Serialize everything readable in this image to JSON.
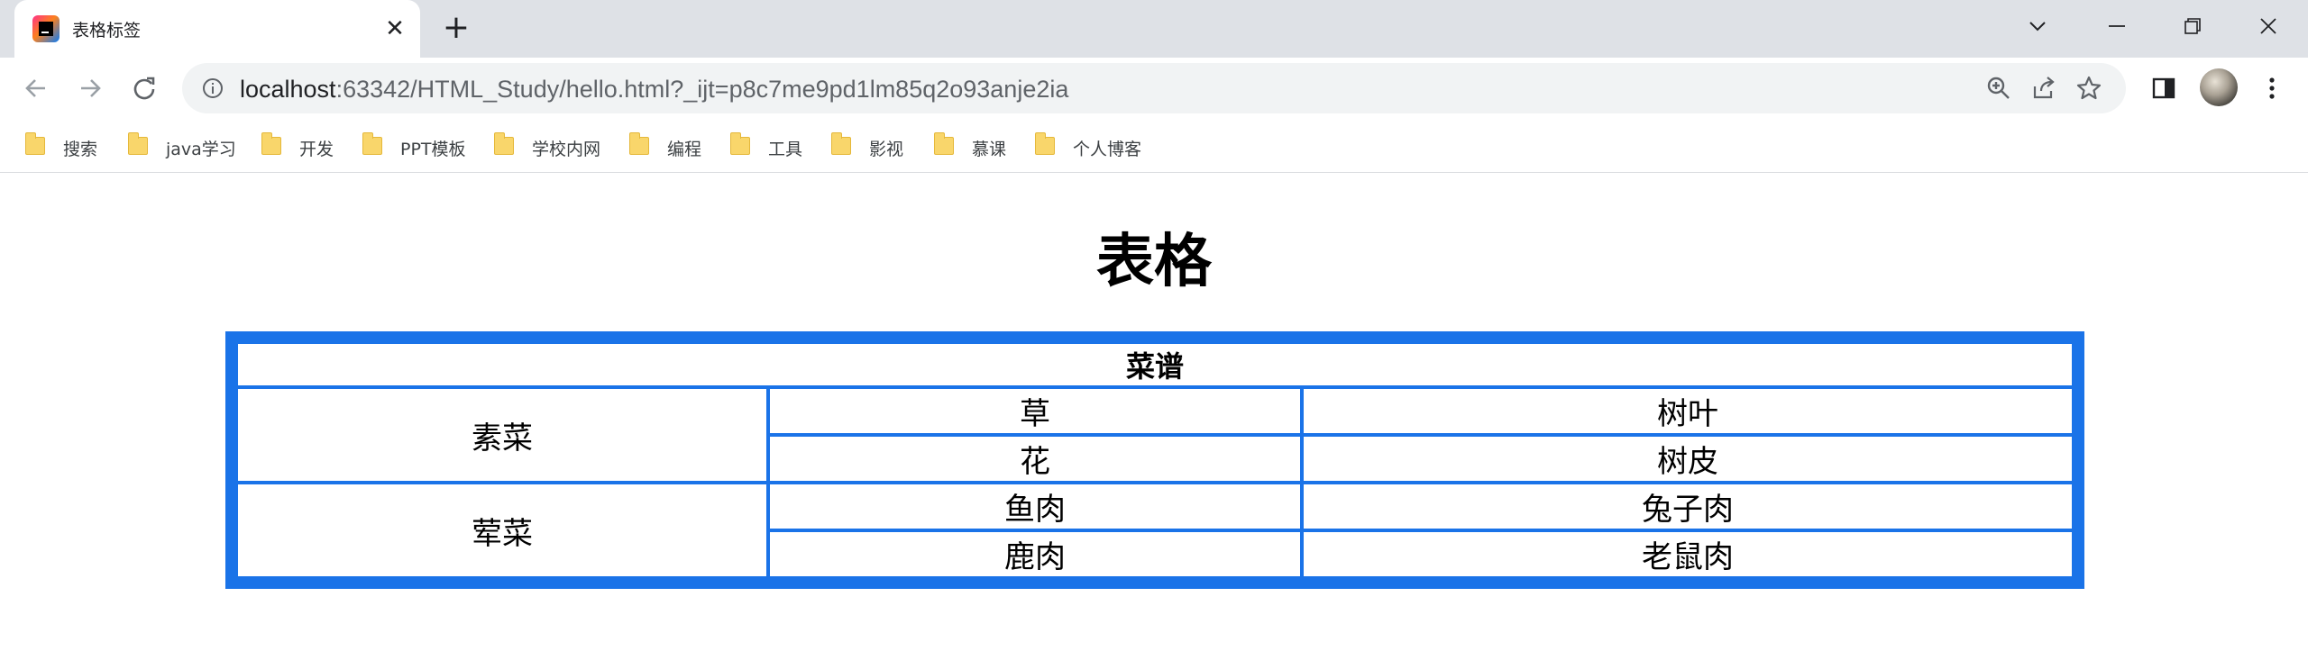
{
  "browser": {
    "tab": {
      "title": "表格标签",
      "close_glyph": "✕"
    },
    "new_tab_glyph": "+",
    "address": {
      "host": "localhost",
      "rest": ":63342/HTML_Study/hello.html?_ijt=p8c7me9pd1lm85q2o93anje2ia"
    },
    "icons": {
      "favicon": "intellij-icon",
      "back": "back-arrow-icon",
      "forward": "forward-arrow-icon",
      "reload": "reload-icon",
      "info": "info-icon",
      "zoom": "zoom-in-icon",
      "share": "share-icon",
      "bookmark": "star-icon",
      "sidepanel": "side-panel-icon",
      "menu": "kebab-menu-icon"
    },
    "bookmarks": [
      {
        "label": "搜索"
      },
      {
        "label": "java学习"
      },
      {
        "label": "开发"
      },
      {
        "label": "PPT模板"
      },
      {
        "label": "学校内网"
      },
      {
        "label": "编程"
      },
      {
        "label": "工具"
      },
      {
        "label": "影视"
      },
      {
        "label": "慕课"
      },
      {
        "label": "个人博客"
      }
    ],
    "accent_color": "#1a73e8"
  },
  "page": {
    "heading": "表格",
    "table": {
      "caption": "菜谱",
      "groups": [
        {
          "name": "素菜",
          "rows": [
            [
              "草",
              "树叶"
            ],
            [
              "花",
              "树皮"
            ]
          ]
        },
        {
          "name": "荤菜",
          "rows": [
            [
              "鱼肉",
              "兔子肉"
            ],
            [
              "鹿肉",
              "老鼠肉"
            ]
          ]
        }
      ]
    }
  }
}
